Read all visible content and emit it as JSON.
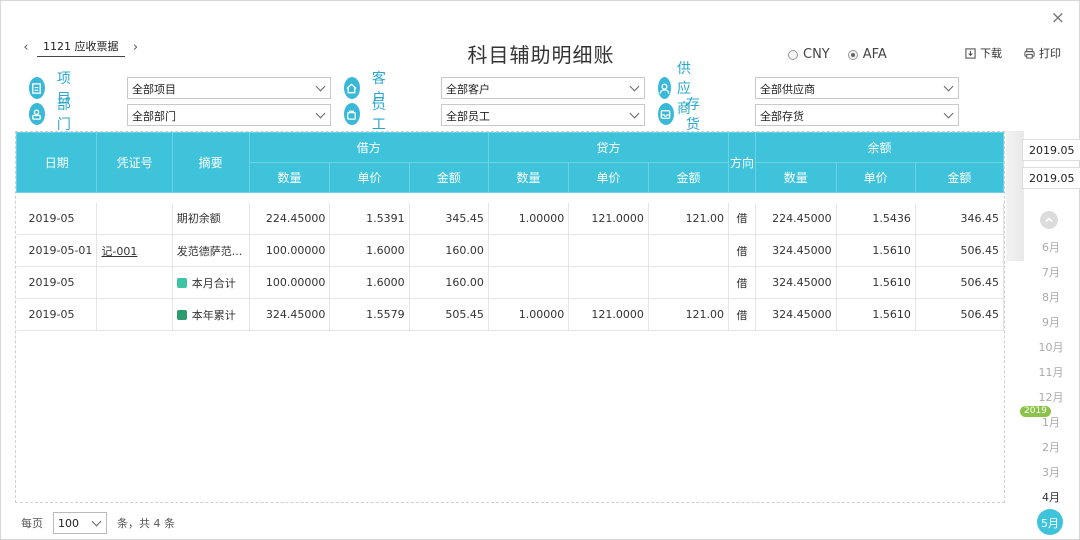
{
  "window": {
    "close_glyph": "×",
    "title": "科目辅助明细账"
  },
  "account_nav": {
    "prev": "‹",
    "next": "›",
    "current": "1121 应收票据"
  },
  "currency": {
    "options": [
      "CNY",
      "AFA"
    ],
    "selected": "AFA"
  },
  "toolbar": {
    "download_label": "下载",
    "print_label": "打印"
  },
  "filters": {
    "project": {
      "label": "项目",
      "value": "全部项目"
    },
    "customer": {
      "label": "客户",
      "value": "全部客户"
    },
    "supplier": {
      "label": "供应商",
      "value": "全部供应商"
    },
    "department": {
      "label": "部门",
      "value": "全部部门"
    },
    "employee": {
      "label": "员工",
      "value": "全部员工"
    },
    "inventory": {
      "label": "存货",
      "value": "全部存货"
    }
  },
  "table": {
    "headers": {
      "date": "日期",
      "voucher": "凭证号",
      "summary": "摘要",
      "debit": "借方",
      "credit": "贷方",
      "direction": "方向",
      "balance": "余额",
      "qty": "数量",
      "price": "单价",
      "amount": "金额"
    },
    "rows": [
      {
        "date": "2019-05",
        "voucher": "",
        "summary": "期初余额",
        "d_qty": "224.45000",
        "d_price": "1.5391",
        "d_amt": "345.45",
        "c_qty": "1.00000",
        "c_price": "121.0000",
        "c_amt": "121.00",
        "dir": "借",
        "b_qty": "224.45000",
        "b_price": "1.5436",
        "b_amt": "346.45"
      },
      {
        "date": "2019-05-01",
        "voucher": "记-001",
        "summary": "发范德萨范...",
        "d_qty": "100.00000",
        "d_price": "1.6000",
        "d_amt": "160.00",
        "c_qty": "",
        "c_price": "",
        "c_amt": "",
        "dir": "借",
        "b_qty": "324.45000",
        "b_price": "1.5610",
        "b_amt": "506.45"
      },
      {
        "date": "2019-05",
        "voucher": "",
        "summary": "本月合计",
        "d_qty": "100.00000",
        "d_price": "1.6000",
        "d_amt": "160.00",
        "c_qty": "",
        "c_price": "",
        "c_amt": "",
        "dir": "借",
        "b_qty": "324.45000",
        "b_price": "1.5610",
        "b_amt": "506.45"
      },
      {
        "date": "2019-05",
        "voucher": "",
        "summary": "本年累计",
        "d_qty": "324.45000",
        "d_price": "1.5579",
        "d_amt": "505.45",
        "c_qty": "1.00000",
        "c_price": "121.0000",
        "c_amt": "121.00",
        "dir": "借",
        "b_qty": "324.45000",
        "b_price": "1.5610",
        "b_amt": "506.45"
      }
    ],
    "badge_colors": {
      "month_total": "#3ec3a5",
      "year_total": "#2e9a70"
    }
  },
  "period": {
    "start": "2019.05",
    "end": "2019.05",
    "months_prev_year": [
      "6月",
      "7月",
      "8月",
      "9月",
      "10月",
      "11月",
      "12月"
    ],
    "year_badge": "2019",
    "months_current_year": [
      "1月",
      "2月",
      "3月",
      "4月",
      "5月"
    ],
    "active_month": "5月"
  },
  "pagination": {
    "per_page_label": "每页",
    "page_size": "100",
    "total_text": "条，共 4 条"
  },
  "colors": {
    "header_bg": "#3ec3da",
    "accent": "#2aa8cc",
    "year_badge": "#8bc34a"
  }
}
